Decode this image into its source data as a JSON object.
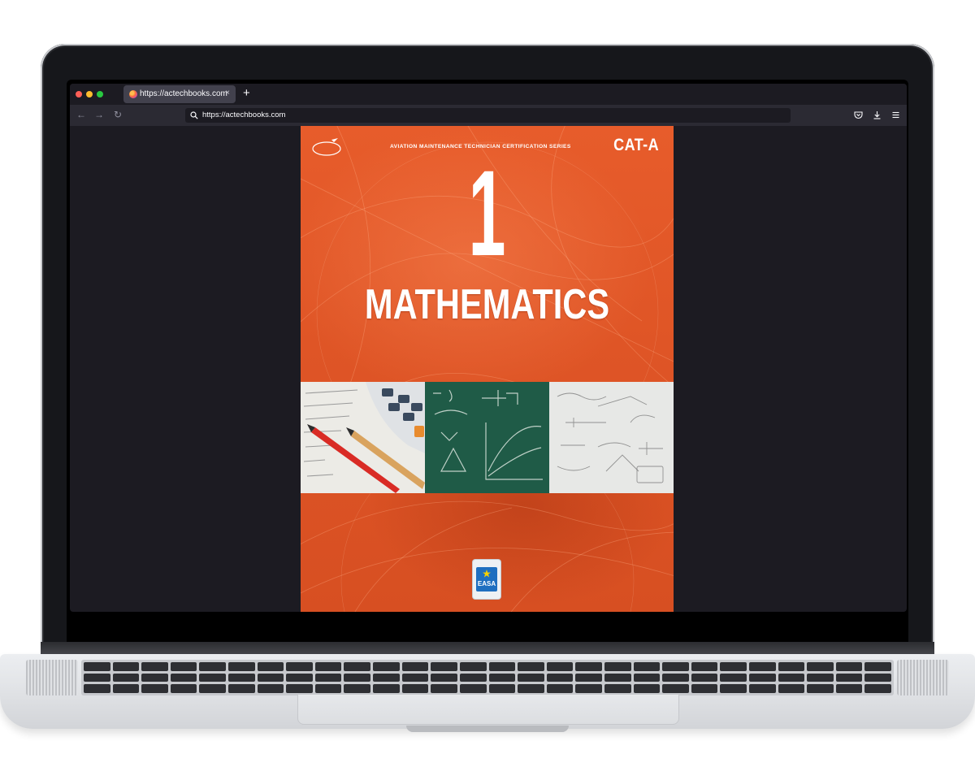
{
  "browser": {
    "tab": {
      "title": "https://actechbooks.com"
    },
    "new_tab_label": "+",
    "close_tab_label": "×",
    "nav": {
      "back": "←",
      "forward": "→",
      "reload": "↻"
    },
    "url": {
      "value": "https://actechbooks.com"
    }
  },
  "cover": {
    "series": "AVIATION MAINTENANCE TECHNICIAN CERTIFICATION SERIES",
    "category": "CAT-A",
    "module_number": "1",
    "title": "MATHEMATICS",
    "badge_label": "EASA",
    "colors": {
      "primary": "#df5526",
      "badge": "#1f6fc0"
    }
  }
}
